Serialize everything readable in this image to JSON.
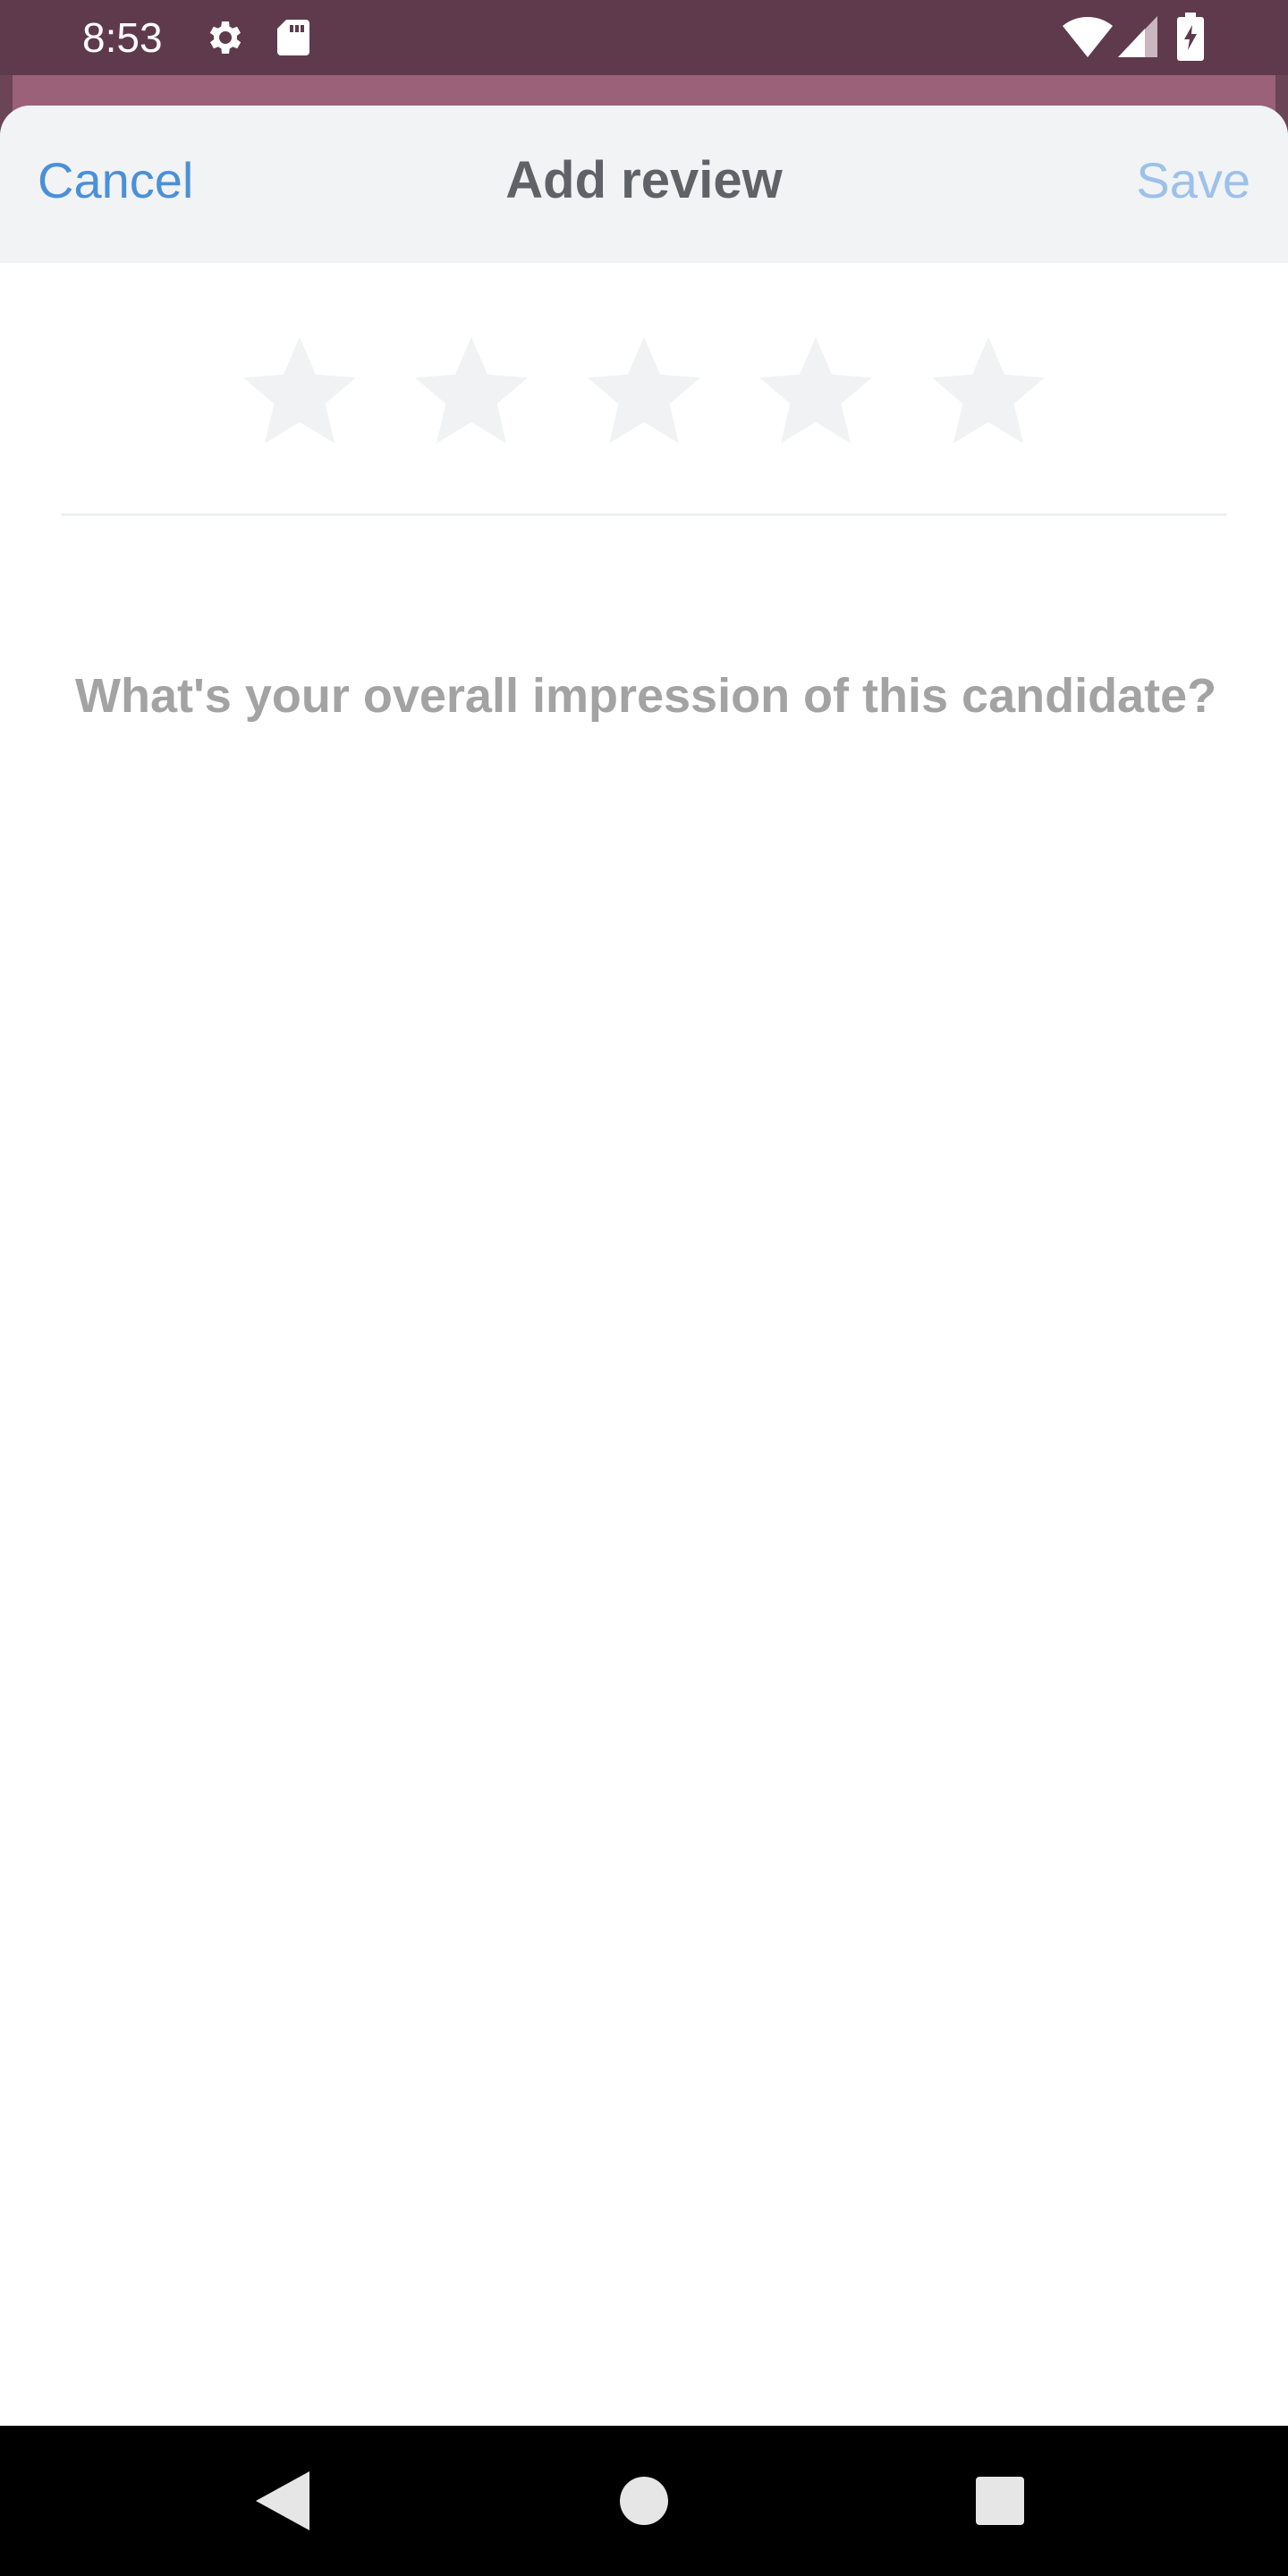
{
  "status_bar": {
    "time": "8:53",
    "icons": [
      "settings-icon",
      "sd-card-icon",
      "wifi-icon",
      "cell-signal-icon",
      "battery-charging-icon"
    ]
  },
  "header": {
    "cancel_label": "Cancel",
    "title": "Add review",
    "save_label": "Save"
  },
  "rating": {
    "value": 0,
    "max": 5,
    "empty_color": "#f1f2f4"
  },
  "review": {
    "placeholder": "What's your overall impression of this candidate?",
    "value": ""
  },
  "nav": {
    "buttons": [
      "back-icon",
      "home-icon",
      "recents-icon"
    ]
  },
  "colors": {
    "accent": "#4a90d9",
    "accent_disabled": "#9cc1ea",
    "status_bar": "#5f3a4c",
    "title_text": "#5f6368",
    "placeholder_text": "#a3a3a3"
  }
}
